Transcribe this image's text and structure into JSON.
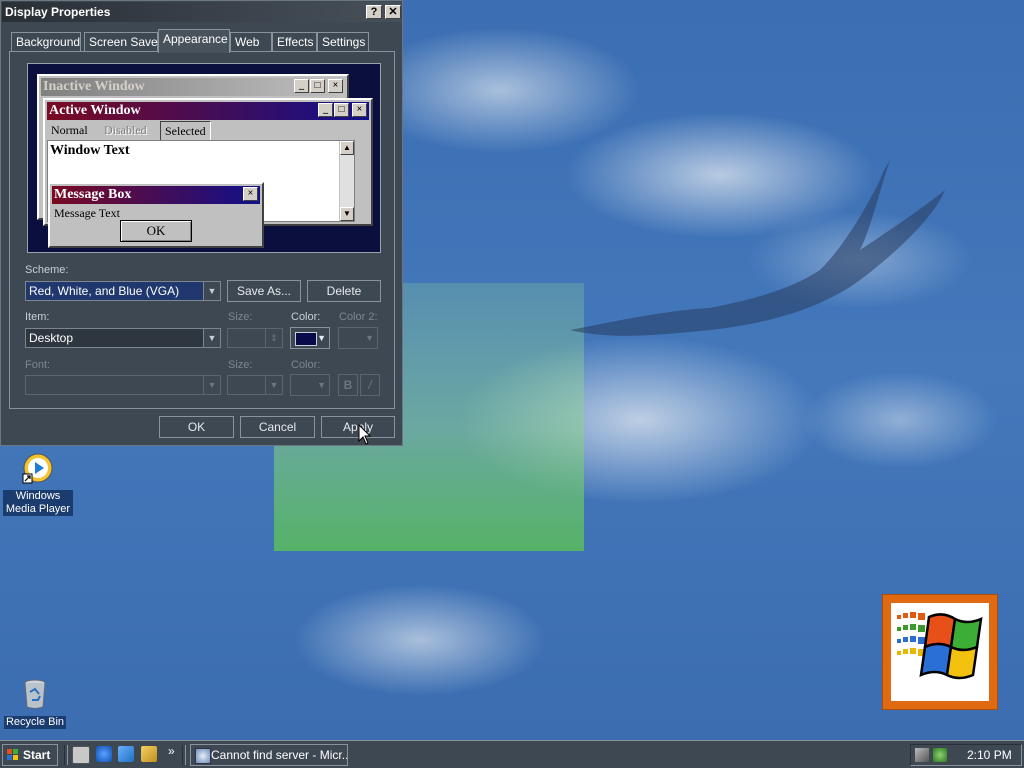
{
  "dialog": {
    "title": "Display Properties",
    "help_label": "?",
    "close_label": "✕",
    "tabs": [
      "Background",
      "Screen Saver",
      "Appearance",
      "Web",
      "Effects",
      "Settings"
    ],
    "active_tab": "Appearance",
    "preview": {
      "inactive_title": "Inactive Window",
      "active_title": "Active Window",
      "menu_normal": "Normal",
      "menu_disabled": "Disabled",
      "menu_selected": "Selected",
      "window_text": "Window Text",
      "msgbox_title": "Message Box",
      "msgbox_text": "Message Text",
      "msgbox_ok": "OK"
    },
    "scheme_label": "Scheme:",
    "scheme_value": "Red, White, and Blue (VGA)",
    "save_as": "Save As...",
    "delete": "Delete",
    "item_label": "Item:",
    "item_value": "Desktop",
    "size_label": "Size:",
    "color_label": "Color:",
    "color2_label": "Color 2:",
    "font_label": "Font:",
    "font_size_label": "Size:",
    "font_color_label": "Color:",
    "bold_label": "B",
    "italic_label": "/",
    "ok": "OK",
    "cancel": "Cancel",
    "apply": "Apply",
    "item_color": "#0a0a4a"
  },
  "desktop": {
    "icons": [
      {
        "label": "Windows Media Player"
      },
      {
        "label": "Recycle Bin"
      }
    ]
  },
  "taskbar": {
    "start": "Start",
    "task_button": "Cannot find server - Micr...",
    "chevron": "»",
    "clock": "2:10 PM"
  }
}
